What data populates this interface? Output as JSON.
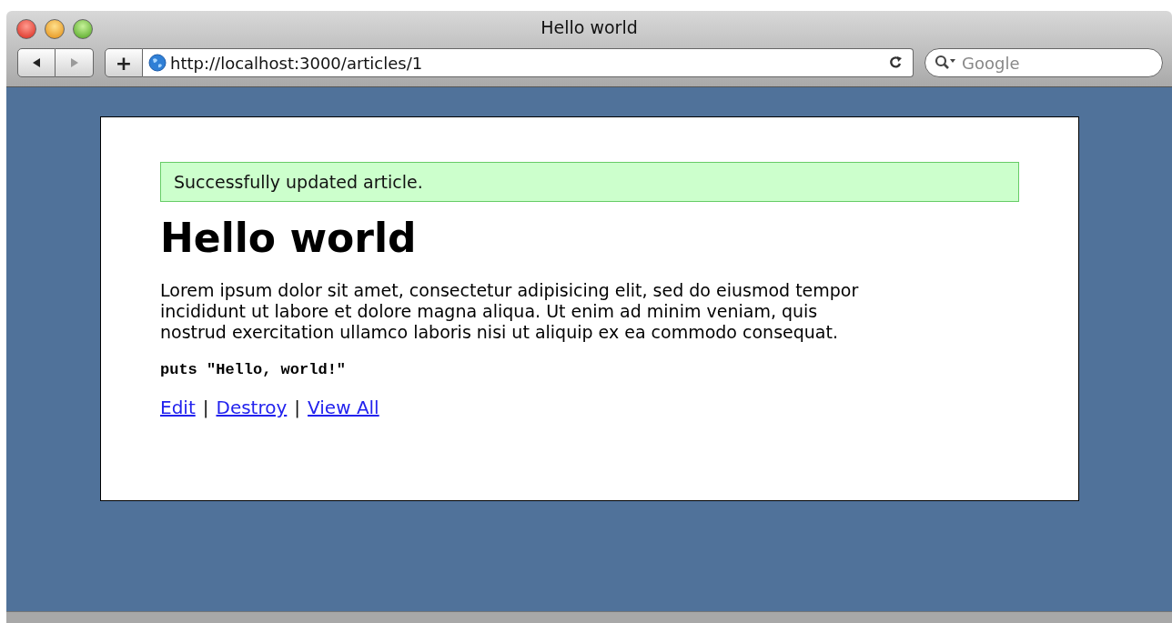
{
  "window": {
    "title": "Hello world"
  },
  "toolbar": {
    "back": {
      "disabled": false
    },
    "forward": {
      "disabled": true
    },
    "add_label": "+",
    "address": "http://localhost:3000/articles/1",
    "search": {
      "placeholder": "Google"
    }
  },
  "page": {
    "notice": "Successfully updated article.",
    "heading": "Hello world",
    "body": "Lorem ipsum dolor sit amet, consectetur adipisicing elit, sed do eiusmod tempor incididunt ut labore et dolore magna aliqua. Ut enim ad minim veniam, quis nostrud exercitation ullamco laboris nisi ut aliquip ex ea commodo consequat.",
    "code": "puts \"Hello, world!\"",
    "links": [
      {
        "label": "Edit"
      },
      {
        "label": "Destroy"
      },
      {
        "label": "View All"
      }
    ],
    "separators": [
      "|",
      "|"
    ]
  }
}
